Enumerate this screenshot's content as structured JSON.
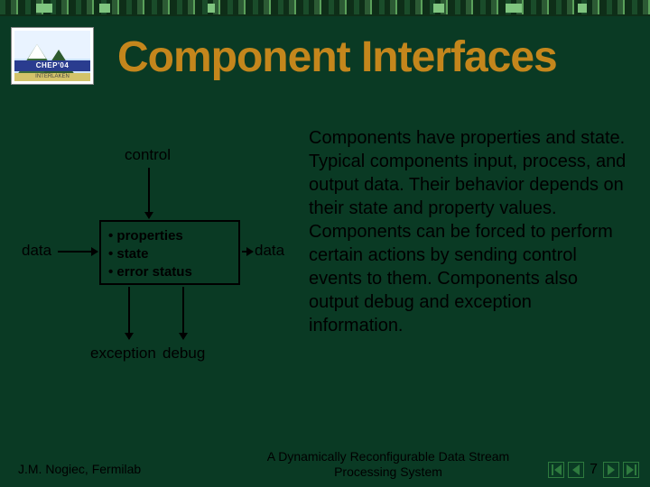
{
  "logo": {
    "banner": "CHEP'04",
    "sub": "INTERLAKEN"
  },
  "title": "Component Interfaces",
  "diagram": {
    "control": "control",
    "data_left": "data",
    "data_right": "data",
    "exception": "exception",
    "debug": "debug",
    "box": {
      "line1": "properties",
      "line2": "state",
      "line3": "error status"
    }
  },
  "body": "Components have properties and state. Typical components input, process, and output data. Their behavior depends on their state and property values. Components can be forced to perform certain actions by sending control events to them. Components also output debug and exception information.",
  "footer": {
    "author": "J.M. Nogiec, Fermilab",
    "project": "A Dynamically Reconfigurable Data Stream Processing System",
    "page": "7"
  },
  "colors": {
    "accent": "#c4861c",
    "bg": "#0a3a24",
    "nav": "#2e7a3e"
  }
}
